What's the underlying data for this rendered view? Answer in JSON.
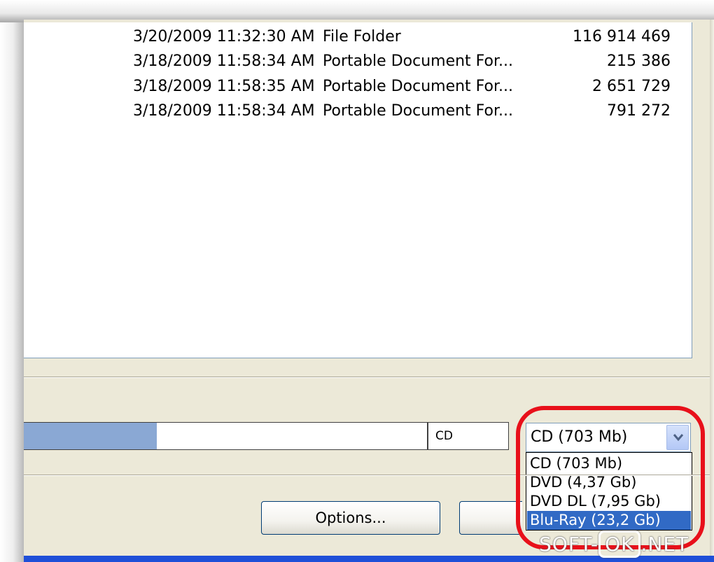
{
  "file_list": {
    "rows": [
      {
        "modified": "3/20/2009 11:32:30 AM",
        "type": "File Folder",
        "size": "116 914 469"
      },
      {
        "modified": "3/18/2009 11:58:34 AM",
        "type": "Portable Document For...",
        "size": "215 386"
      },
      {
        "modified": "3/18/2009 11:58:35 AM",
        "type": "Portable Document For...",
        "size": "2 651 729"
      },
      {
        "modified": "3/18/2009 11:58:34 AM",
        "type": "Portable Document For...",
        "size": "791 272"
      }
    ]
  },
  "capacity": {
    "fill_fraction": 0.33,
    "media_label": "CD",
    "fill_color": "#8aa8d4"
  },
  "media_select": {
    "selected": "CD (703 Mb)",
    "options": [
      "CD (703 Mb)",
      "DVD (4,37 Gb)",
      "DVD DL (7,95 Gb)",
      "Blu-Ray (23,2 Gb)"
    ],
    "highlighted": "Blu-Ray (23,2 Gb)",
    "highlight_color": "#316ac5",
    "annotation_ring_color": "#e8101a"
  },
  "buttons": {
    "options_label": "Options...",
    "second_label": ""
  },
  "watermark": {
    "left": "SOFT-",
    "box": "OK",
    "right": ".NET"
  }
}
